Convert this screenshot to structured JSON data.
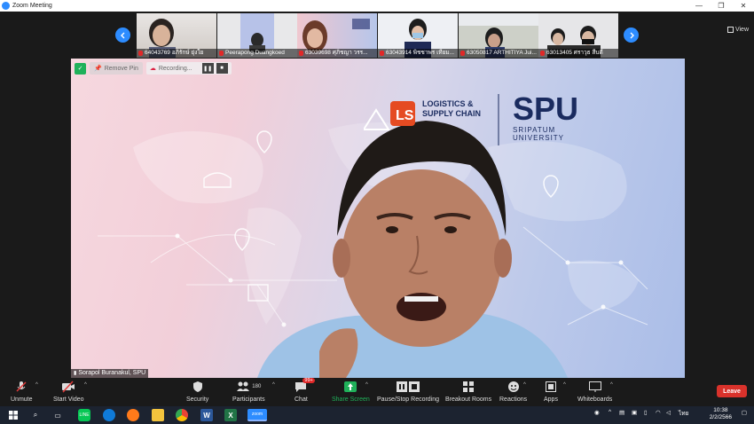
{
  "window": {
    "title": "Zoom Meeting",
    "controls": [
      "—",
      "❐",
      "✕"
    ]
  },
  "gallery": {
    "view_label": "View",
    "participants": [
      {
        "name": "64043769 อภิรักษ์ ยุ่งใย",
        "muted": true
      },
      {
        "name": "Peerapong Duangkoed",
        "muted": true
      },
      {
        "name": "63039698 ศุภิชญา วรร...",
        "muted": true
      },
      {
        "name": "63043914 พิชชาพร เทียม...",
        "muted": true
      },
      {
        "name": "63050817 ARTHITIYA Jui...",
        "muted": true
      },
      {
        "name": "63013405 ศราวุธ สืบดี",
        "muted": true
      }
    ]
  },
  "main": {
    "remove_pin": "Remove Pin",
    "recording": "Recording...",
    "speaker": "Sorapol Buranakul, SPU",
    "brand_left_line1": "LOGISTICS &",
    "brand_left_line2": "SUPPLY CHAIN",
    "brand_right_big": "SPU",
    "brand_right_line1": "SRIPATUM",
    "brand_right_line2": "UNIVERSITY"
  },
  "toolbar": {
    "unmute": "Unmute",
    "start_video": "Start Video",
    "security": "Security",
    "participants": "Participants",
    "participants_count": "180",
    "chat": "Chat",
    "chat_badge": "99+",
    "share_screen": "Share Screen",
    "pause_stop_recording": "Pause/Stop Recording",
    "breakout_rooms": "Breakout Rooms",
    "reactions": "Reactions",
    "apps": "Apps",
    "whiteboards": "Whiteboards",
    "leave": "Leave"
  },
  "taskbar": {
    "language": "ไทย",
    "time": "10:38",
    "date": "2/2/2566"
  },
  "colors": {
    "accent": "#2d8cff",
    "leave": "#d9322b",
    "share": "#20b15a"
  }
}
